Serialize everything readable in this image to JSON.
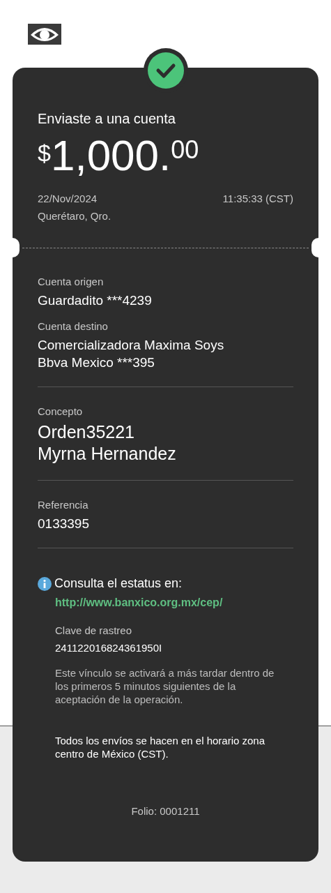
{
  "header": {
    "title": "Enviaste a una cuenta",
    "currency": "$",
    "amount": "1,000.",
    "cents": "00",
    "date": "22/Nov/2024",
    "time": "11:35:33 (CST)",
    "place": "Querétaro, Qro."
  },
  "sections": [
    {
      "fields": [
        {
          "label": "Cuenta origen",
          "kind": "normal",
          "lines": [
            "Guardadito ***4239"
          ]
        },
        {
          "label": "Cuenta destino",
          "kind": "normal",
          "lines": [
            "Comercializadora Maxima Soys",
            "Bbva Mexico ***395"
          ]
        }
      ]
    },
    {
      "fields": [
        {
          "label": "Concepto",
          "kind": "large",
          "lines": [
            "Orden35221",
            "Myrna Hernandez"
          ]
        }
      ]
    },
    {
      "fields": [
        {
          "label": "Referencia",
          "kind": "normal",
          "lines": [
            "0133395"
          ]
        }
      ]
    }
  ],
  "status": {
    "prompt": "Consulta el estatus en:",
    "link": "http://www.banxico.org.mx/cep/",
    "tracking_label": "Clave de rastreo",
    "tracking_value": "241122016824361950I",
    "note": "Este vínculo se activará a más tardar dentro de los primeros 5 minutos siguientes de la aceptación de la operación."
  },
  "footer_note": "Todos los envíos se hacen en el horario zona centro de México (CST).",
  "folio": "Folio: 0001211"
}
